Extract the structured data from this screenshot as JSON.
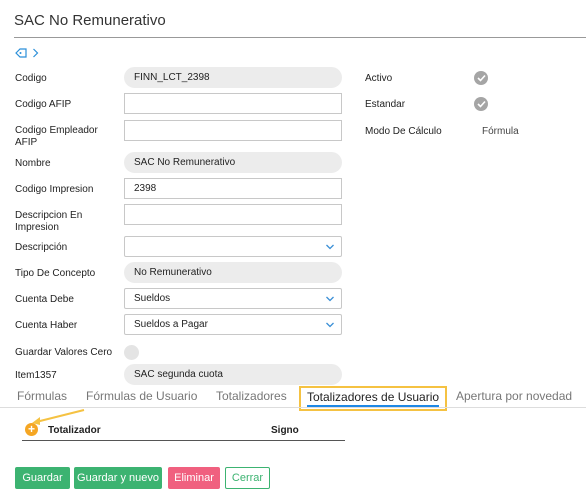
{
  "page": {
    "title": "SAC No Remunerativo"
  },
  "form": {
    "codigo": {
      "label": "Codigo",
      "value": "FINN_LCT_2398"
    },
    "codigo_afip": {
      "label": "Codigo AFIP",
      "value": ""
    },
    "codigo_empleador": {
      "label_line1": "Codigo Empleador",
      "label_line2": "AFIP",
      "value": ""
    },
    "nombre": {
      "label": "Nombre",
      "value": "SAC No Remunerativo"
    },
    "codigo_impresion": {
      "label": "Codigo Impresion",
      "value": "2398"
    },
    "descripcion_impresion": {
      "label_line1": "Descripcion En",
      "label_line2": "Impresion",
      "value": ""
    },
    "descripcion": {
      "label": "Descripción",
      "value": ""
    },
    "tipo_concepto": {
      "label": "Tipo De Concepto",
      "value": "No Remunerativo"
    },
    "cuenta_debe": {
      "label": "Cuenta Debe",
      "value": "Sueldos"
    },
    "cuenta_haber": {
      "label": "Cuenta Haber",
      "value": "Sueldos a Pagar"
    },
    "guardar_valores_cero": {
      "label": "Guardar Valores Cero"
    },
    "item1357": {
      "label": "Item1357",
      "value": "SAC segunda cuota"
    }
  },
  "right": {
    "activo": {
      "label": "Activo"
    },
    "estandar": {
      "label": "Estandar"
    },
    "modo_calculo": {
      "label": "Modo De Cálculo",
      "value": "Fórmula"
    }
  },
  "tabs": [
    {
      "label": "Fórmulas"
    },
    {
      "label": "Fórmulas de Usuario"
    },
    {
      "label": "Totalizadores"
    },
    {
      "label": "Totalizadores de Usuario"
    },
    {
      "label": "Apertura por novedad"
    }
  ],
  "table": {
    "col_totalizador": "Totalizador",
    "col_signo": "Signo"
  },
  "buttons": {
    "guardar": "Guardar",
    "guardar_nuevo": "Guardar y nuevo",
    "eliminar": "Eliminar",
    "cerrar": "Cerrar"
  },
  "colors": {
    "accent": "#1e88e5",
    "highlight": "#f5c242",
    "success": "#3cb371",
    "danger": "#f0607f"
  }
}
